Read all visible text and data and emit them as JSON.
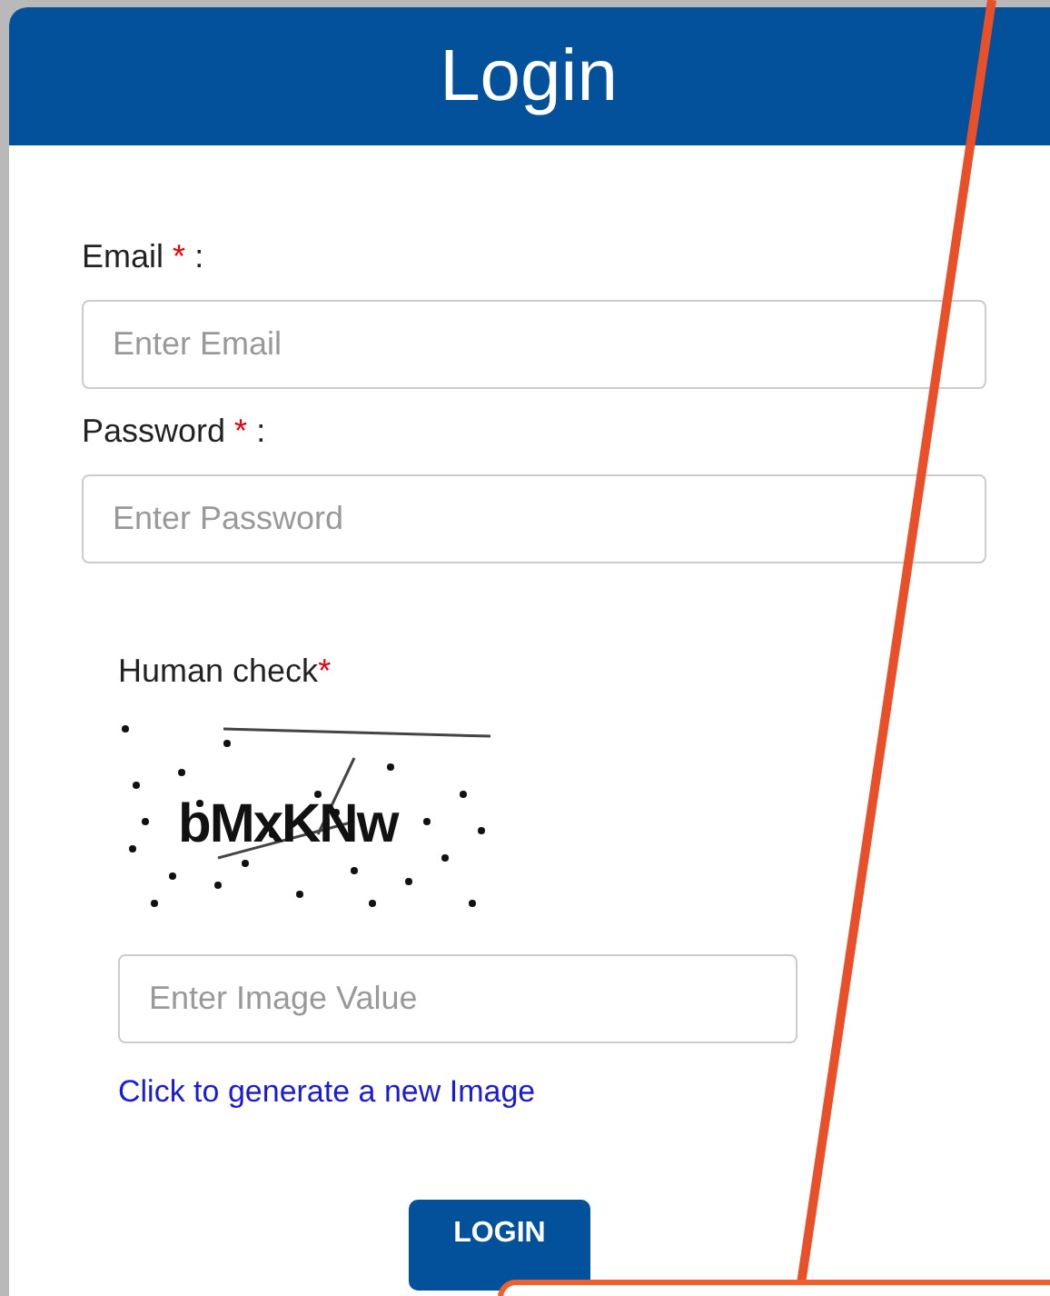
{
  "dialog": {
    "title": "Login"
  },
  "fields": [
    {
      "label": "Email",
      "required_mark": "*",
      "colon": ":",
      "placeholder": "Enter Email"
    },
    {
      "label": "Password",
      "required_mark": "*",
      "colon": ":",
      "placeholder": "Enter Password"
    }
  ],
  "human_check": {
    "label": "Human check",
    "required_mark": "*",
    "captcha_text": "bMxKNw",
    "placeholder": "Enter Image Value",
    "refresh_link": "Click to generate a new Image"
  },
  "login_button": "LOGIN"
}
